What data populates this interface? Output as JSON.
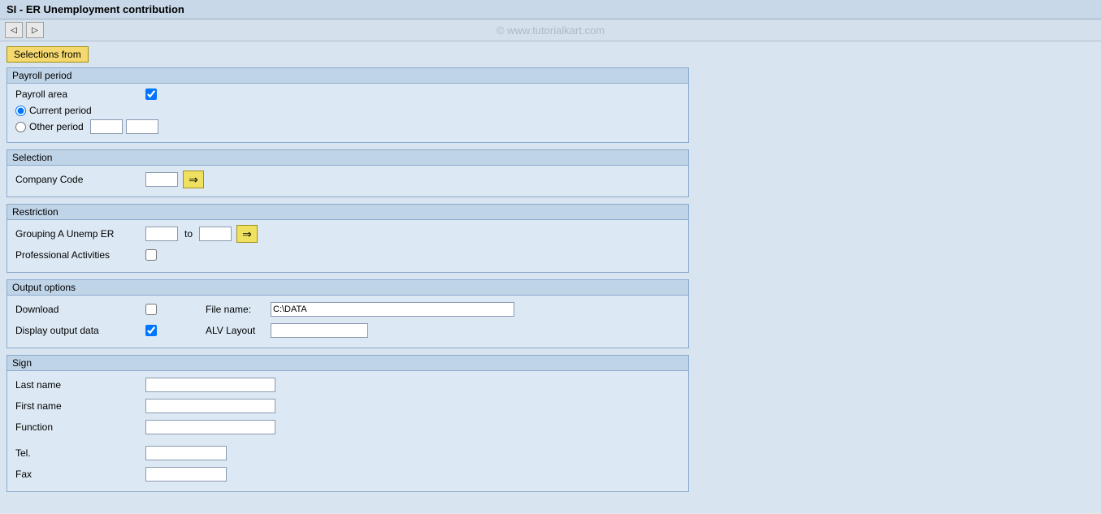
{
  "title": "SI - ER Unemployment contribution",
  "watermark": "© www.tutorialkart.com",
  "toolbar": {
    "btn1": "◁",
    "btn2": "▷"
  },
  "selections_button": "Selections from",
  "sections": {
    "payroll_period": {
      "header": "Payroll period",
      "payroll_area_label": "Payroll area",
      "current_period_label": "Current period",
      "other_period_label": "Other period"
    },
    "selection": {
      "header": "Selection",
      "company_code_label": "Company Code"
    },
    "restriction": {
      "header": "Restriction",
      "grouping_label": "Grouping A Unemp ER",
      "to_label": "to",
      "professional_label": "Professional Activities"
    },
    "output_options": {
      "header": "Output options",
      "download_label": "Download",
      "file_name_label": "File name:",
      "file_name_value": "C:\\DATA",
      "display_output_label": "Display output data",
      "alv_layout_label": "ALV Layout"
    },
    "sign": {
      "header": "Sign",
      "last_name_label": "Last name",
      "first_name_label": "First name",
      "function_label": "Function",
      "tel_label": "Tel.",
      "fax_label": "Fax"
    }
  }
}
